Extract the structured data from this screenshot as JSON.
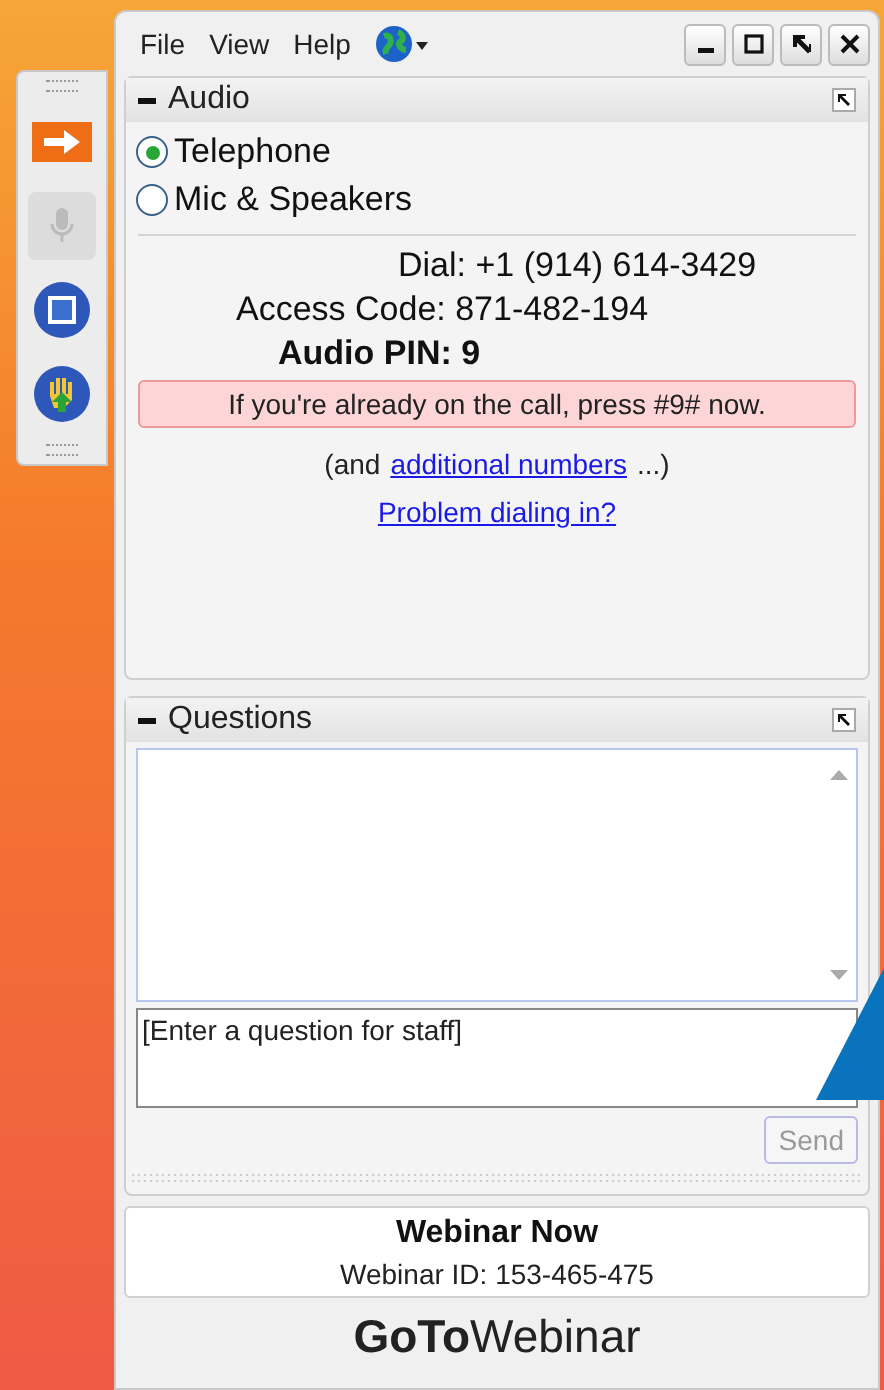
{
  "menu": [
    "File",
    "View",
    "Help"
  ],
  "audio": {
    "title": "Audio",
    "options": [
      {
        "label": "Telephone",
        "selected": true
      },
      {
        "label": "Mic & Speakers",
        "selected": false
      }
    ],
    "dial": "Dial: +1 (914) 614-3429",
    "access_code": "Access Code: 871-482-194",
    "audio_pin": "Audio PIN: 9",
    "notice": "If you're already on the call, press #9# now.",
    "more_prefix": "(and",
    "more_link": "additional numbers",
    "more_suffix": "...)",
    "problem_link": "Problem dialing in?"
  },
  "questions": {
    "title": "Questions",
    "input": {
      "placeholder": "[Enter a question for staff]"
    },
    "send_button": {
      "label": "Send",
      "disabled": true
    }
  },
  "footer": {
    "title": "Webinar Now",
    "webinar_id": "Webinar ID: 153-465-475",
    "logo": "**GoTo**Webinar"
  }
}
